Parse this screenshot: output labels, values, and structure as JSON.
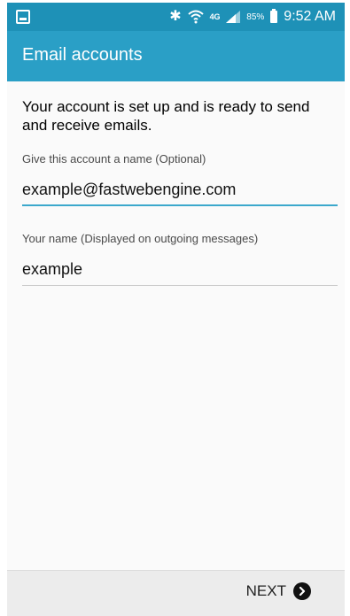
{
  "status_bar": {
    "left_icon": "image-notification-icon",
    "network_label": "4G",
    "battery_percent": "85%",
    "time": "9:52 AM"
  },
  "app_bar": {
    "title": "Email accounts"
  },
  "main": {
    "intro_text": "Your account is set up and is ready to send and receive emails.",
    "account_name": {
      "label": "Give this account a name (Optional)",
      "value": "example@fastwebengine.com"
    },
    "your_name": {
      "label": "Your name (Displayed on outgoing messages)",
      "value": "example"
    }
  },
  "footer": {
    "next_label": "NEXT",
    "next_icon": "chevron-right-circle-icon"
  },
  "colors": {
    "status_bar": "#1e91b7",
    "app_bar": "#2a9fc6",
    "focus_underline": "#3ba8cc",
    "background": "#fafafa",
    "bottom_bar": "#ececec"
  }
}
